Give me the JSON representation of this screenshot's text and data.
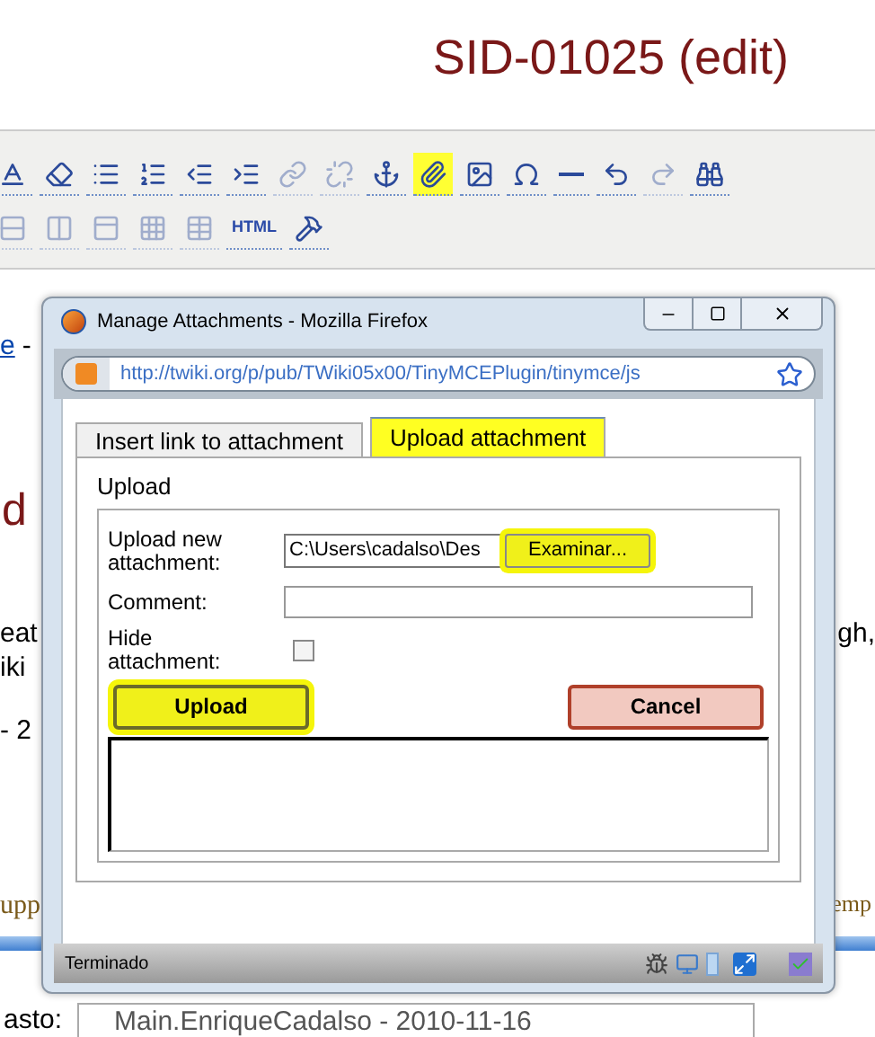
{
  "page_title": "SID-01025 (edit)",
  "toolbar_rows": [
    [
      {
        "disabled": false,
        "highlighted": false
      },
      {
        "disabled": false,
        "highlighted": false
      },
      {
        "disabled": false,
        "highlighted": false
      },
      {
        "disabled": false,
        "highlighted": false
      },
      {
        "disabled": false,
        "highlighted": false
      },
      {
        "disabled": false,
        "highlighted": false
      },
      {
        "disabled": true,
        "highlighted": false
      },
      {
        "disabled": true,
        "highlighted": false
      },
      {
        "disabled": false,
        "highlighted": false
      },
      {
        "disabled": false,
        "highlighted": true
      },
      {
        "disabled": false,
        "highlighted": false
      },
      {
        "disabled": false,
        "highlighted": false
      },
      {
        "disabled": false,
        "highlighted": false
      },
      {
        "disabled": false,
        "highlighted": false
      },
      {
        "disabled": true,
        "highlighted": false
      },
      {
        "disabled": false,
        "highlighted": false
      }
    ],
    [
      {
        "disabled": true,
        "highlighted": false
      },
      {
        "disabled": true,
        "highlighted": false
      },
      {
        "disabled": true,
        "highlighted": false
      },
      {
        "disabled": true,
        "highlighted": false
      },
      {
        "disabled": true,
        "highlighted": false
      },
      {
        "disabled": false,
        "highlighted": false,
        "label": "HTML"
      },
      {
        "disabled": false,
        "highlighted": false
      }
    ]
  ],
  "background": {
    "link_fragment": "e",
    "dash": "-",
    "heading_fragment": "d",
    "left_lines": [
      "eat",
      "iki",
      "- 2"
    ],
    "right_line": "gh,",
    "code_left": "upp",
    "code_right": "emp",
    "field_label": "asto:",
    "field_value": "Main.EnriqueCadalso - 2010-11-16"
  },
  "dialog": {
    "title": "Manage Attachments - Mozilla Firefox",
    "url": "http://twiki.org/p/pub/TWiki05x00/TinyMCEPlugin/tinymce/js",
    "tabs": [
      {
        "label": "Insert link to attachment",
        "selected": false,
        "highlighted": false
      },
      {
        "label": "Upload attachment",
        "selected": true,
        "highlighted": true
      }
    ],
    "fieldset": "Upload",
    "file_label": "Upload new attachment:",
    "file_value": "C:\\Users\\cadalso\\Des",
    "browse_button": {
      "label": "Examinar...",
      "highlighted": true
    },
    "comment_label": "Comment:",
    "hide_label": "Hide attachment:",
    "hide_checked": false,
    "upload_button": {
      "label": "Upload",
      "highlighted": true
    },
    "cancel_button": {
      "label": "Cancel",
      "highlighted": false
    },
    "status": "Terminado"
  }
}
